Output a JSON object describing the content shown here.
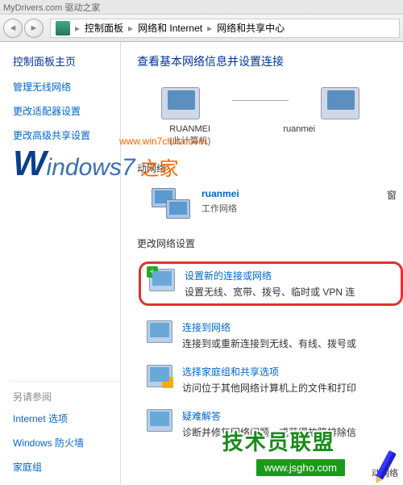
{
  "titlebar": "MyDrivers.com 驱动之家",
  "breadcrumb": {
    "items": [
      "控制面板",
      "网络和 Internet",
      "网络和共享中心"
    ]
  },
  "sidebar": {
    "title": "控制面板主页",
    "links": [
      "管理无线网络",
      "更改适配器设置",
      "更改高级共享设置"
    ],
    "see_also_label": "另请参阅",
    "see_also_items": [
      "Internet 选项",
      "Windows 防火墙",
      "家庭组"
    ]
  },
  "main": {
    "title": "查看基本网络信息并设置连接",
    "device1": {
      "name": "RUANMEI",
      "subtitle": "(此计算机)"
    },
    "device2": {
      "name": "ruanmei"
    },
    "view_label": "动网络",
    "active_net": {
      "name": "ruanmei",
      "type": "工作网络"
    },
    "change_section": "更改网络设置",
    "actions": [
      {
        "title": "设置新的连接或网络",
        "desc": "设置无线、宽带、拨号、临时或 VPN 连"
      },
      {
        "title": "连接到网络",
        "desc": "连接到或重新连接到无线、有线、拨号或"
      },
      {
        "title": "选择家庭组和共享选项",
        "desc": "访问位于其他网络计算机上的文件和打印"
      },
      {
        "title": "疑难解答",
        "desc": "诊断并修复网络问题，或获得故障排除信"
      }
    ],
    "trail_text": "动网络",
    "side_cut": "窗"
  },
  "watermark": {
    "main": "Windows7",
    "suffix": "之家",
    "url": "www.win7china.com"
  },
  "footer_watermark": {
    "text": "技术员联盟",
    "url": "www.jsgho.com"
  }
}
